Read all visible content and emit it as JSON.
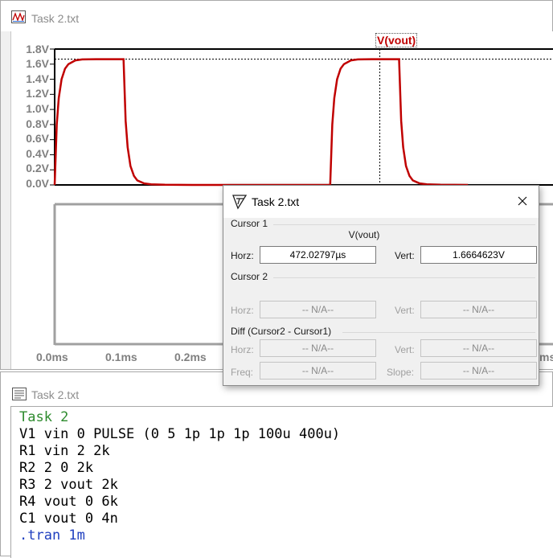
{
  "waveform_window": {
    "title": "Task 2.txt",
    "trace_label": "V(vout)",
    "trace_color": "#c00000",
    "y_ticks": [
      "1.8V",
      "1.6V",
      "1.4V",
      "1.2V",
      "1.0V",
      "0.8V",
      "0.6V",
      "0.4V",
      "0.2V",
      "0.0V"
    ],
    "x_ticks": [
      "0.0ms",
      "0.1ms",
      "0.2ms",
      "ms"
    ]
  },
  "chart_data": {
    "type": "line",
    "series": [
      {
        "name": "V(vout)",
        "x": [
          0,
          3,
          6,
          10,
          15,
          20,
          30,
          40,
          60,
          100,
          103,
          106,
          110,
          115,
          120,
          130,
          140,
          160,
          200,
          400,
          403,
          406,
          410,
          415,
          420,
          430,
          440,
          460,
          500,
          503,
          506,
          510,
          515,
          520,
          530,
          540,
          560,
          600
        ],
        "y": [
          0,
          0.8,
          1.15,
          1.4,
          1.54,
          1.6,
          1.65,
          1.663,
          1.666,
          1.666,
          0.85,
          0.5,
          0.25,
          0.12,
          0.06,
          0.02,
          0.007,
          0.002,
          0,
          0,
          0.8,
          1.15,
          1.4,
          1.54,
          1.6,
          1.65,
          1.663,
          1.666,
          1.666,
          0.85,
          0.5,
          0.25,
          0.12,
          0.06,
          0.02,
          0.007,
          0.002,
          0
        ]
      }
    ],
    "xunit": "µs",
    "ylim": [
      0,
      1.8
    ],
    "xlim": [
      0,
      600
    ],
    "cursor": {
      "x": 472.02797,
      "y": 1.6664623
    }
  },
  "netlist_window": {
    "title": "Task 2.txt",
    "comment_color": "#2e8b2e",
    "directive_color": "#1f3fbf",
    "lines": [
      {
        "text": "Task 2",
        "kind": "comment"
      },
      {
        "text": "V1 vin 0 PULSE (0 5 1p 1p 1p 100u 400u)",
        "kind": "normal"
      },
      {
        "text": "R1 vin 2 2k",
        "kind": "normal"
      },
      {
        "text": "R2 2 0 2k",
        "kind": "normal"
      },
      {
        "text": "R3 2 vout 2k",
        "kind": "normal"
      },
      {
        "text": "R4 vout 0 6k",
        "kind": "normal"
      },
      {
        "text": "C1 vout 0 4n",
        "kind": "normal"
      },
      {
        "text": ".tran 1m",
        "kind": "directive"
      }
    ]
  },
  "cursor_dialog": {
    "title": "Task 2.txt",
    "cursor1": {
      "label": "Cursor 1",
      "trace": "V(vout)",
      "horz_label": "Horz:",
      "horz_value": "472.02797µs",
      "vert_label": "Vert:",
      "vert_value": "1.6664623V"
    },
    "cursor2": {
      "label": "Cursor 2",
      "horz_label": "Horz:",
      "horz_value": "-- N/A--",
      "vert_label": "Vert:",
      "vert_value": "-- N/A--"
    },
    "diff": {
      "label": "Diff (Cursor2 - Cursor1)",
      "horz_label": "Horz:",
      "horz_value": "-- N/A--",
      "vert_label": "Vert:",
      "vert_value": "-- N/A--",
      "freq_label": "Freq:",
      "freq_value": "-- N/A--",
      "slope_label": "Slope:",
      "slope_value": "-- N/A--"
    }
  }
}
